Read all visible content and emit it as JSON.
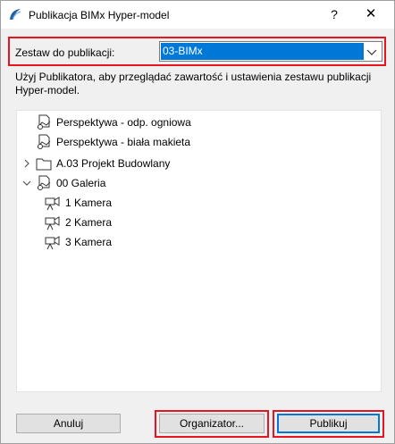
{
  "window": {
    "title": "Publikacja BIMx Hyper-model",
    "help_label": "?",
    "close_label": "✕"
  },
  "set": {
    "label": "Zestaw do publikacji:",
    "selected": "03-BIMx"
  },
  "info_text": "Użyj Publikatora, aby przeglądać zawartość i ustawienia zestawu publikacji Hyper-model.",
  "tree": {
    "items": [
      {
        "label": "Perspektywa - odp. ogniowa",
        "icon": "view-icon"
      },
      {
        "label": "Perspektywa - biała makieta",
        "icon": "view-icon"
      },
      {
        "label": "A.03 Projekt Budowlany",
        "icon": "folder-icon",
        "expanded": false
      },
      {
        "label": "00 Galeria",
        "icon": "view-icon",
        "expanded": true
      },
      {
        "label": "1 Kamera",
        "icon": "camera-icon"
      },
      {
        "label": "2 Kamera",
        "icon": "camera-icon"
      },
      {
        "label": "3 Kamera",
        "icon": "camera-icon"
      }
    ]
  },
  "buttons": {
    "cancel": "Anuluj",
    "organizer": "Organizator...",
    "publish": "Publikuj"
  },
  "colors": {
    "highlight": "#e8141e",
    "selection": "#0078d7"
  }
}
